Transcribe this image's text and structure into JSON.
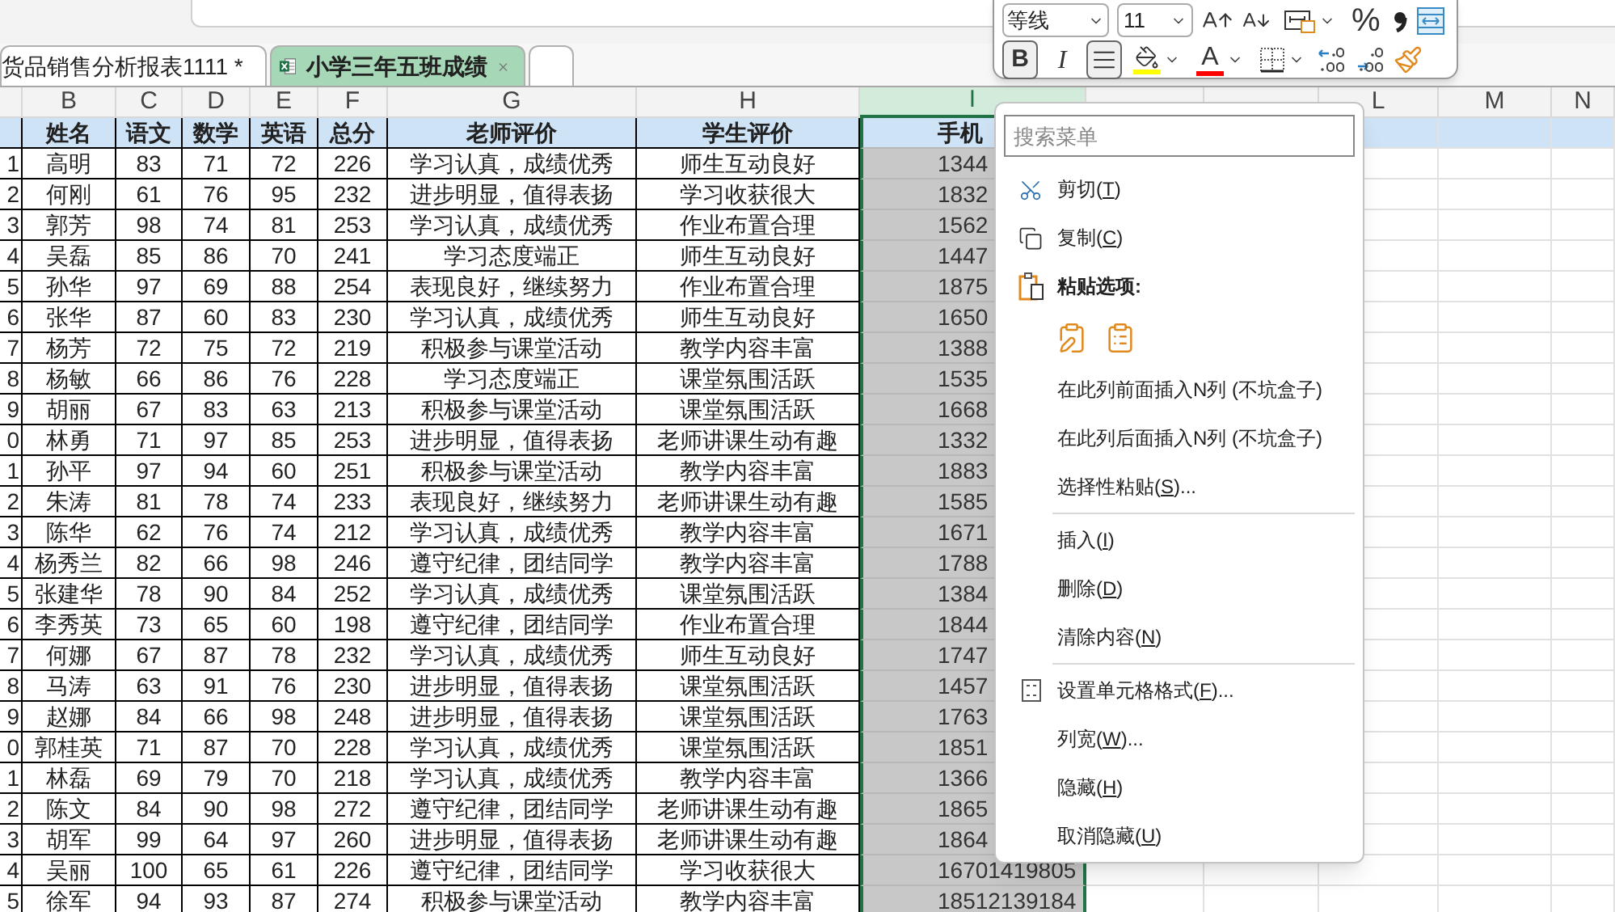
{
  "tabs": [
    {
      "label": "货品销售分析报表1111 *",
      "selected": false,
      "closable": false
    },
    {
      "label": "小学三年五班成绩",
      "selected": true,
      "closable": true
    }
  ],
  "column_headers": [
    {
      "label": "B",
      "selected": false
    },
    {
      "label": "C",
      "selected": false
    },
    {
      "label": "D",
      "selected": false
    },
    {
      "label": "E",
      "selected": false
    },
    {
      "label": "F",
      "selected": false
    },
    {
      "label": "G",
      "selected": false
    },
    {
      "label": "H",
      "selected": false
    },
    {
      "label": "I",
      "selected": true
    },
    {
      "selected": false
    },
    {
      "selected": false
    },
    {
      "label": "L",
      "selected": false
    },
    {
      "label": "M",
      "selected": false
    },
    {
      "label": "N",
      "selected": false
    }
  ],
  "sheet": {
    "header": [
      "姓名",
      "语文",
      "数学",
      "英语",
      "总分",
      "老师评价",
      "学生评价",
      "手机"
    ],
    "rows": [
      [
        "1",
        "高明",
        "83",
        "71",
        "72",
        "226",
        "学习认真，成绩优秀",
        "师生互动良好",
        "1344"
      ],
      [
        "2",
        "何刚",
        "61",
        "76",
        "95",
        "232",
        "进步明显，值得表扬",
        "学习收获很大",
        "1832"
      ],
      [
        "3",
        "郭芳",
        "98",
        "74",
        "81",
        "253",
        "学习认真，成绩优秀",
        "作业布置合理",
        "1562"
      ],
      [
        "4",
        "吴磊",
        "85",
        "86",
        "70",
        "241",
        "学习态度端正",
        "师生互动良好",
        "1447"
      ],
      [
        "5",
        "孙华",
        "97",
        "69",
        "88",
        "254",
        "表现良好，继续努力",
        "作业布置合理",
        "1875"
      ],
      [
        "6",
        "张华",
        "87",
        "60",
        "83",
        "230",
        "学习认真，成绩优秀",
        "师生互动良好",
        "1650"
      ],
      [
        "7",
        "杨芳",
        "72",
        "75",
        "72",
        "219",
        "积极参与课堂活动",
        "教学内容丰富",
        "1388"
      ],
      [
        "8",
        "杨敏",
        "66",
        "86",
        "76",
        "228",
        "学习态度端正",
        "课堂氛围活跃",
        "1535"
      ],
      [
        "9",
        "胡丽",
        "67",
        "83",
        "63",
        "213",
        "积极参与课堂活动",
        "课堂氛围活跃",
        "1668"
      ],
      [
        "0",
        "林勇",
        "71",
        "97",
        "85",
        "253",
        "进步明显，值得表扬",
        "老师讲课生动有趣",
        "1332"
      ],
      [
        "1",
        "孙平",
        "97",
        "94",
        "60",
        "251",
        "积极参与课堂活动",
        "教学内容丰富",
        "1883"
      ],
      [
        "2",
        "朱涛",
        "81",
        "78",
        "74",
        "233",
        "表现良好，继续努力",
        "老师讲课生动有趣",
        "1585"
      ],
      [
        "3",
        "陈华",
        "62",
        "76",
        "74",
        "212",
        "学习认真，成绩优秀",
        "教学内容丰富",
        "1671"
      ],
      [
        "4",
        "杨秀兰",
        "82",
        "66",
        "98",
        "246",
        "遵守纪律，团结同学",
        "教学内容丰富",
        "1788"
      ],
      [
        "5",
        "张建华",
        "78",
        "90",
        "84",
        "252",
        "学习认真，成绩优秀",
        "课堂氛围活跃",
        "1384"
      ],
      [
        "6",
        "李秀英",
        "73",
        "65",
        "60",
        "198",
        "遵守纪律，团结同学",
        "作业布置合理",
        "1844"
      ],
      [
        "7",
        "何娜",
        "67",
        "87",
        "78",
        "232",
        "学习认真，成绩优秀",
        "师生互动良好",
        "1747"
      ],
      [
        "8",
        "马涛",
        "63",
        "91",
        "76",
        "230",
        "进步明显，值得表扬",
        "课堂氛围活跃",
        "1457"
      ],
      [
        "9",
        "赵娜",
        "84",
        "66",
        "98",
        "248",
        "进步明显，值得表扬",
        "课堂氛围活跃",
        "1763"
      ],
      [
        "0",
        "郭桂英",
        "71",
        "87",
        "70",
        "228",
        "学习认真，成绩优秀",
        "课堂氛围活跃",
        "1851"
      ],
      [
        "1",
        "林磊",
        "69",
        "79",
        "70",
        "218",
        "学习认真，成绩优秀",
        "教学内容丰富",
        "1366"
      ],
      [
        "2",
        "陈文",
        "84",
        "90",
        "98",
        "272",
        "遵守纪律，团结同学",
        "老师讲课生动有趣",
        "1865"
      ],
      [
        "3",
        "胡军",
        "99",
        "64",
        "97",
        "260",
        "进步明显，值得表扬",
        "老师讲课生动有趣",
        "1864"
      ],
      [
        "4",
        "吴丽",
        "100",
        "65",
        "61",
        "226",
        "遵守纪律，团结同学",
        "学习收获很大",
        "16701419805"
      ],
      [
        "5",
        "徐军",
        "94",
        "93",
        "87",
        "274",
        "积极参与课堂活动",
        "教学内容丰富",
        "18512139184"
      ]
    ]
  },
  "toolbar": {
    "font_name": "等线",
    "font_size": "11",
    "row1": [
      {
        "kind": "grow-font"
      },
      {
        "kind": "shrink-font"
      },
      {
        "kind": "merge",
        "dropdown": true
      },
      {
        "kind": "percent",
        "label": "%"
      },
      {
        "kind": "comma"
      },
      {
        "kind": "wrap"
      }
    ],
    "row2": [
      {
        "kind": "bold",
        "label": "B",
        "selected": true
      },
      {
        "kind": "italic",
        "label": "I",
        "selected": false
      },
      {
        "kind": "align",
        "selected": true
      },
      {
        "kind": "fill",
        "color": "#ffff00",
        "dropdown": true
      },
      {
        "kind": "font-color",
        "label": "A",
        "color": "#ff0000",
        "dropdown": true
      },
      {
        "kind": "borders",
        "dropdown": true
      },
      {
        "kind": "increase-decimal"
      },
      {
        "kind": "decrease-decimal"
      },
      {
        "kind": "format-painter"
      }
    ]
  },
  "context_menu": {
    "search_placeholder": "搜索菜单",
    "items": [
      {
        "kind": "cut",
        "label": "剪切(T)"
      },
      {
        "kind": "copy",
        "label": "复制(C)"
      },
      {
        "kind": "heading",
        "label": "粘贴选项:"
      },
      {
        "kind": "paste-icons"
      },
      {
        "kind": "item",
        "label": "在此列前面插入N列 (不坑盒子)"
      },
      {
        "kind": "item",
        "label": "在此列后面插入N列 (不坑盒子)"
      },
      {
        "kind": "item",
        "label": "选择性粘贴(S)..."
      },
      {
        "kind": "separator"
      },
      {
        "kind": "item",
        "label": "插入(I)"
      },
      {
        "kind": "item",
        "label": "删除(D)"
      },
      {
        "kind": "item",
        "label": "清除内容(N)"
      },
      {
        "kind": "separator"
      },
      {
        "kind": "format-cells",
        "label": "设置单元格格式(F)..."
      },
      {
        "kind": "item",
        "label": "列宽(W)..."
      },
      {
        "kind": "item",
        "label": "隐藏(H)"
      },
      {
        "kind": "item",
        "label": "取消隐藏(U)"
      }
    ]
  }
}
